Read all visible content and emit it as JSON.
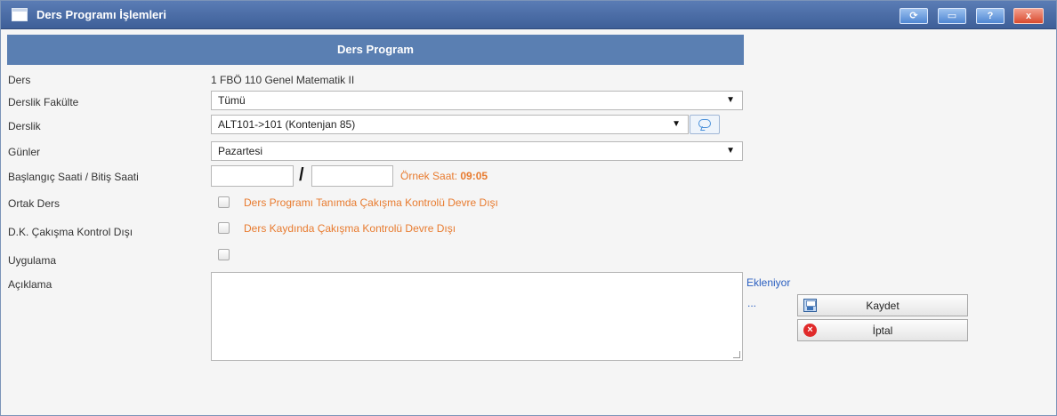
{
  "window": {
    "title": "Ders Programı İşlemleri",
    "controls": {
      "refresh": "⟳",
      "restore": "▭",
      "help": "?",
      "close": "x"
    }
  },
  "form": {
    "header": "Ders Program",
    "labels": {
      "ders": "Ders",
      "derslik_fakulte": "Derslik Fakülte",
      "derslik": "Derslik",
      "gunler": "Günler",
      "saat": "Başlangıç Saati / Bitiş Saati",
      "ortak_ders": "Ortak Ders",
      "dk_cakisma": "D.K. Çakışma Kontrol Dışı",
      "uygulama": "Uygulama",
      "aciklama": "Açıklama"
    },
    "values": {
      "ders": "1 FBÖ 110 Genel Matematik II",
      "derslik_fakulte": "Tümü",
      "derslik": "ALT101->101 (Kontenjan 85)",
      "gunler": "Pazartesi",
      "start_time": "",
      "end_time": "",
      "aciklama": ""
    },
    "time_separator": "/",
    "example_time_label": "Örnek Saat:",
    "example_time_value": "09:05",
    "checkbox_texts": {
      "ortak_ders": "Ders Programı Tanımda Çakışma Kontrolü Devre Dışı",
      "dk_cakisma": "Ders Kaydında Çakışma Kontrolü Devre Dışı"
    },
    "status_text": "Ekleniyor",
    "status_dots": "...",
    "buttons": {
      "save": "Kaydet",
      "cancel": "İptal"
    }
  },
  "icons": {
    "chat": "chat-bubble-icon",
    "save": "save-icon",
    "cancel": "cancel-icon"
  },
  "colors": {
    "header": "#5a7fb2",
    "accent_orange": "#e87b2f",
    "link_blue": "#2a5fc0",
    "title_bar": "#3e5f98"
  }
}
